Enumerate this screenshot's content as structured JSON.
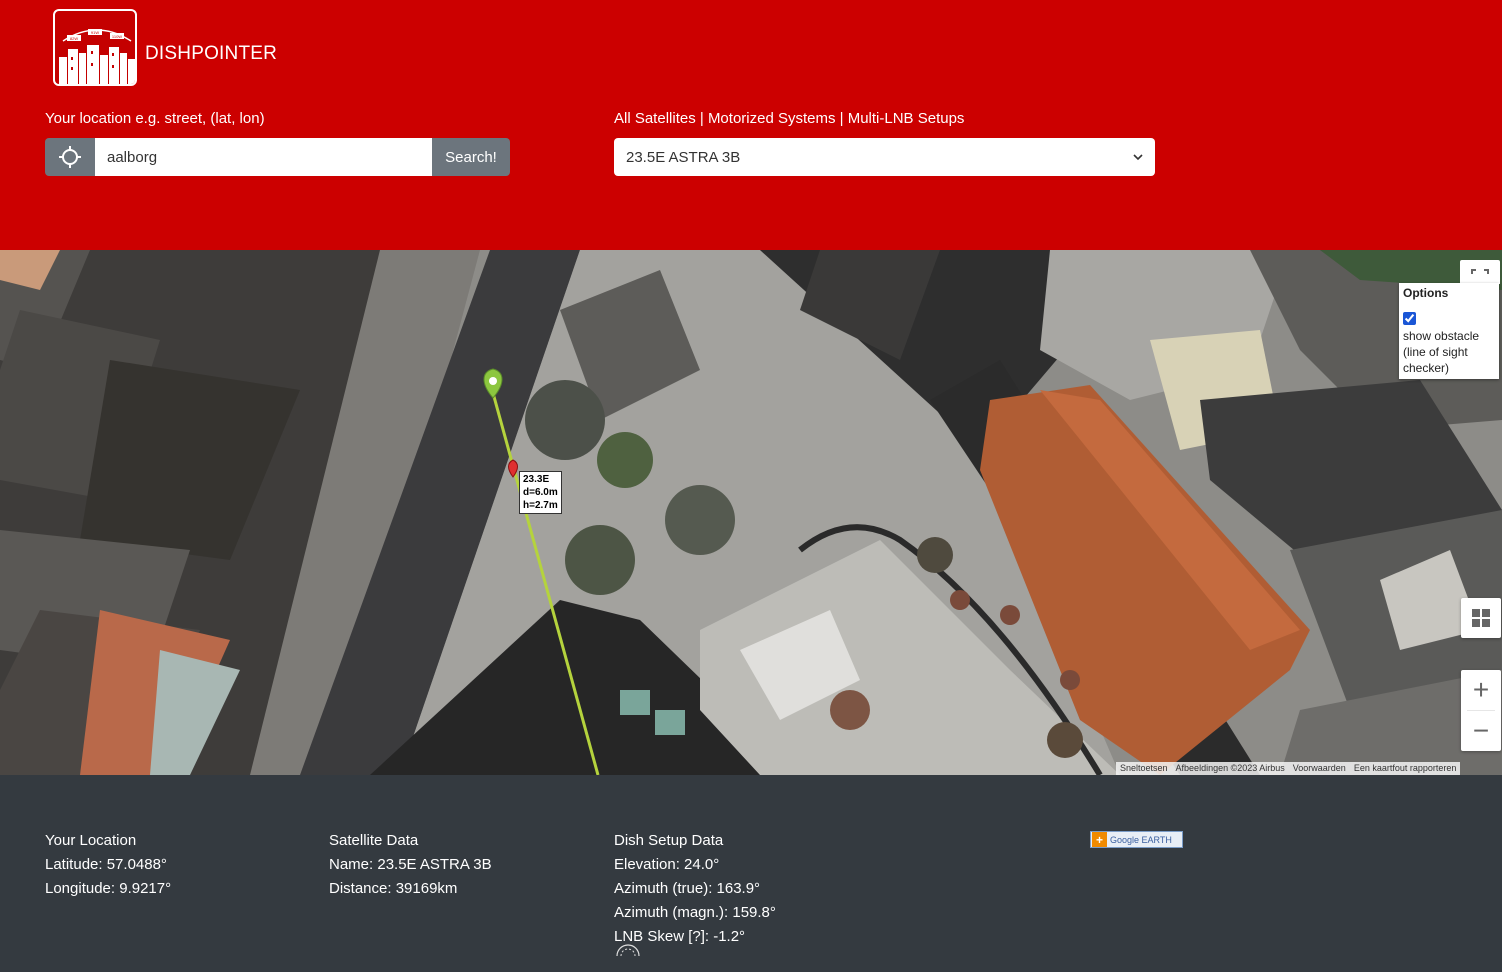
{
  "header": {
    "brand": "DISHPOINTER",
    "logo_labels": [
      "82W",
      "91W",
      "110W"
    ],
    "location_label": "Your location e.g. street, (lat, lon)",
    "sat_links": [
      "All Satellites",
      "Motorized Systems",
      "Multi-LNB Setups"
    ],
    "sat_link_separator": " | ",
    "search_value": "aalborg",
    "search_button": "Search!",
    "selected_satellite": "23.5E ASTRA 3B",
    "locate_icon": "crosshair-icon",
    "select_icon": "chevron-down-icon"
  },
  "map": {
    "marker_label": [
      "23.3E",
      "d=6.0m",
      "h=2.7m"
    ],
    "options_title": "Options",
    "show_obstacle_checked": true,
    "show_obstacle_label": "show obstacle (line of sight checker)",
    "zoom_in": "+",
    "zoom_out": "−",
    "attribution": [
      "Sneltoetsen",
      "Afbeeldingen ©2023 Airbus",
      "Voorwaarden",
      "Een kaartfout rapporteren"
    ],
    "icons": {
      "fullscreen": "fullscreen-icon",
      "layers": "layers-icon",
      "location_marker": "location-pin-icon",
      "obstacle_marker": "obstacle-pin-icon"
    }
  },
  "footer": {
    "location": {
      "heading": "Your Location",
      "latitude": "Latitude: 57.0488°",
      "longitude": "Longitude: 9.9217°"
    },
    "satellite": {
      "heading": "Satellite Data",
      "name": "Name: 23.5E ASTRA 3B",
      "distance": "Distance: 39169km"
    },
    "dish": {
      "heading": "Dish Setup Data",
      "elevation": "Elevation:  24.0°",
      "azimuth_true": "Azimuth (true):  163.9°",
      "azimuth_magn": "Azimuth (magn.):  159.8°",
      "lnb_skew": "LNB Skew [?]:  -1.2°"
    },
    "google_earth": "Google EARTH"
  },
  "colors": {
    "header_bg": "#cc0000",
    "footer_bg": "#343a40",
    "button_gray": "#6c757d",
    "sight_line": "#b5d33d"
  }
}
